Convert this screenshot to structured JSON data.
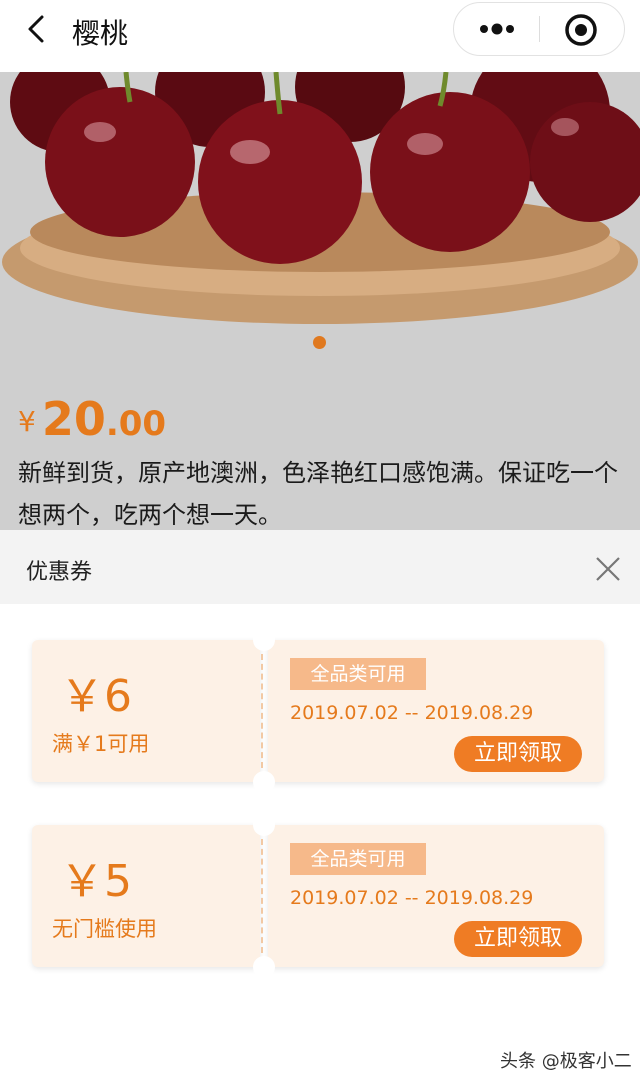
{
  "header": {
    "title": "樱桃",
    "back_icon": "back-chevron-icon",
    "more_icon": "more-dots-icon",
    "close_icon": "target-close-icon"
  },
  "product": {
    "price_symbol": "¥",
    "price_integer": "20",
    "price_decimal": ".00",
    "description": "新鲜到货，原产地澳洲，色泽艳红口感饱满。保证吃一个想两个，吃两个想一天。",
    "accent_color": "#e57a1c"
  },
  "coupon_sheet": {
    "title": "优惠券",
    "coupons": [
      {
        "amount": "￥6",
        "condition": "满￥1可用",
        "tag": "全品类可用",
        "validity": "2019.07.02 -- 2019.08.29",
        "button": "立即领取"
      },
      {
        "amount": "￥5",
        "condition": "无门槛使用",
        "tag": "全品类可用",
        "validity": "2019.07.02 -- 2019.08.29",
        "button": "立即领取"
      }
    ]
  },
  "watermark": "头条 @极客小二"
}
